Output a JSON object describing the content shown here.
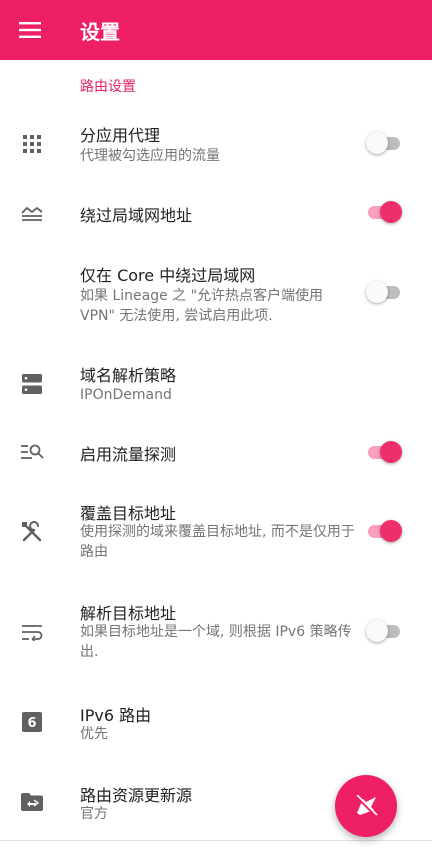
{
  "appbar": {
    "title": "设置",
    "menu_icon": "hamburger-menu-icon"
  },
  "section": {
    "header": "路由设置"
  },
  "items": [
    {
      "title": "分应用代理",
      "summary": "代理被勾选应用的流量",
      "icon": "grid-apps-icon",
      "switch": false
    },
    {
      "title": "绕过局域网地址",
      "summary": "",
      "icon": "lan-bypass-icon",
      "switch": true
    },
    {
      "title": "仅在 Core 中绕过局域网",
      "summary": "如果 Lineage 之 \"允许热点客户端使用 VPN\" 无法使用, 尝试启用此项.",
      "icon": "",
      "switch": false
    },
    {
      "title": "域名解析策略",
      "summary": "IPOnDemand",
      "icon": "dns-server-icon"
    },
    {
      "title": "启用流量探测",
      "summary": "",
      "icon": "sniff-search-icon",
      "switch": true
    },
    {
      "title": "覆盖目标地址",
      "summary": "使用探测的域来覆盖目标地址, 而不是仅用于路由",
      "icon": "tools-icon",
      "switch": true
    },
    {
      "title": "解析目标地址",
      "summary": "如果目标地址是一个域, 则根据 IPv6 策略传出.",
      "icon": "wrap-text-icon",
      "switch": false
    },
    {
      "title": "IPv6 路由",
      "summary": "优先",
      "icon": "ipv6-six-icon"
    },
    {
      "title": "路由资源更新源",
      "summary": "官方",
      "icon": "folder-update-icon"
    }
  ],
  "fab": {
    "icon": "plane-off-icon"
  }
}
